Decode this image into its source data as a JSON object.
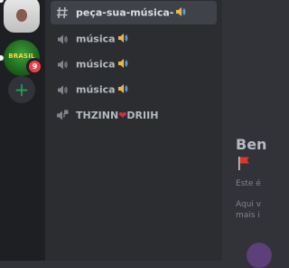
{
  "servers": {
    "brasil_label": "BRASIL",
    "brasil_badge": "9",
    "add_label": "+"
  },
  "channels": [
    {
      "type": "text",
      "label": "peça-sua-música-",
      "active": true
    },
    {
      "type": "voice",
      "label": "música",
      "active": false
    },
    {
      "type": "voice",
      "label": "música",
      "active": false
    },
    {
      "type": "voice",
      "label": "música",
      "active": false
    },
    {
      "type": "voice-locked",
      "label_left": "THZINN",
      "label_right": "DRIIH",
      "active": false
    }
  ],
  "main": {
    "welcome_title": "Ben",
    "welcome_sub": "Este é",
    "welcome_sub2_line1": "Aqui v",
    "welcome_sub2_line2": "mais i"
  },
  "colors": {
    "rail": "#1e1f22",
    "sidebar": "#2b2d31",
    "main": "#313338",
    "active": "#404249",
    "badge": "#f23f43",
    "add": "#23a55a"
  }
}
